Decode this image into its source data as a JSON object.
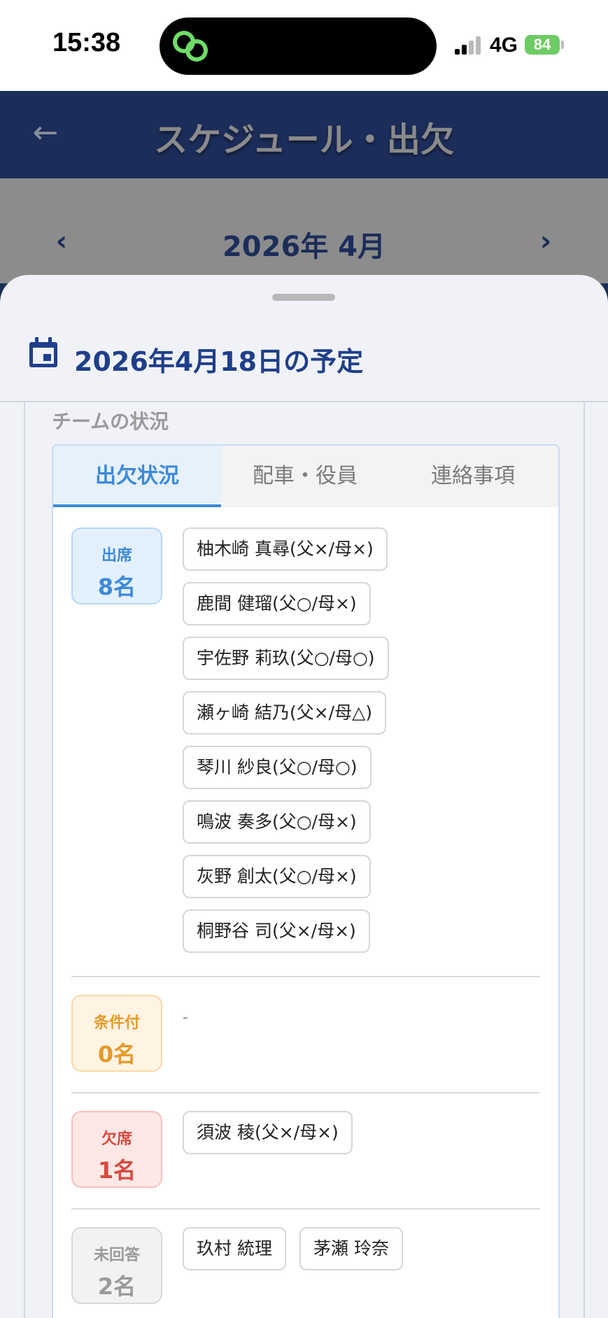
{
  "status": {
    "time": "15:38",
    "network": "4G",
    "battery": "84"
  },
  "header": {
    "title": "スケジュール・出欠"
  },
  "month": {
    "label": "2026年 4月"
  },
  "sheet": {
    "title": "2026年4月18日の予定",
    "team_label": "チームの状況"
  },
  "tabs": [
    "出欠状況",
    "配車・役員",
    "連絡事項"
  ],
  "groups": {
    "attend": {
      "label": "出席",
      "count": "8名"
    },
    "conditional": {
      "label": "条件付",
      "count": "0名",
      "empty": "-"
    },
    "absent": {
      "label": "欠席",
      "count": "1名"
    },
    "noreply": {
      "label": "未回答",
      "count": "2名"
    }
  },
  "attendees": [
    "柚木崎 真尋(父×/母×)",
    "鹿間 健瑠(父○/母×)",
    "宇佐野 莉玖(父○/母○)",
    "瀬ヶ崎 結乃(父×/母△)",
    "琴川 紗良(父○/母○)",
    "鳴波 奏多(父○/母×)",
    "灰野 創太(父○/母×)",
    "桐野谷 司(父×/母×)"
  ],
  "absentees": [
    "須波 稜(父×/母×)"
  ],
  "noreply_members": [
    "玖村 統理",
    "茅瀬 玲奈"
  ]
}
